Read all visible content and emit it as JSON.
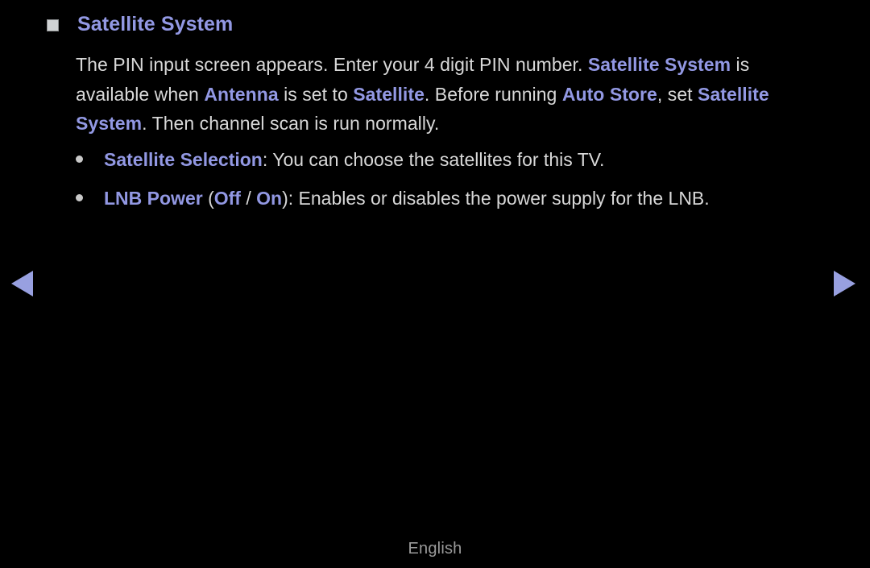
{
  "accent_color": "#9298e3",
  "text_color": "#d8d8d8",
  "background_color": "#000000",
  "header": {
    "marker_icon": "filled-square-icon",
    "title": "Satellite System"
  },
  "paragraph": {
    "seg_1": "The PIN input screen appears. Enter your 4 digit PIN number. ",
    "seg_2_accent": "Satellite System",
    "seg_3": " is available when ",
    "seg_4_accent": "Antenna",
    "seg_5": " is set to ",
    "seg_6_accent": "Satellite",
    "seg_7": ". Before running ",
    "seg_8_accent": "Auto Store",
    "seg_9": ", set ",
    "seg_10_accent": "Satellite System",
    "seg_11": ". Then channel scan is run normally."
  },
  "bullets": [
    {
      "icon": "bullet-dot-icon",
      "label_accent": "Satellite Selection",
      "description": ": You can choose the satellites for this TV."
    },
    {
      "icon": "bullet-dot-icon",
      "label_accent": "LNB Power",
      "paren_open": " (",
      "option_off": "Off",
      "option_separator": " / ",
      "option_on": "On",
      "paren_close": ")",
      "description": ": Enables or disables the power supply for the LNB."
    }
  ],
  "navigation": {
    "previous_icon": "triangle-left-icon",
    "next_icon": "triangle-right-icon"
  },
  "footer": {
    "language": "English"
  }
}
